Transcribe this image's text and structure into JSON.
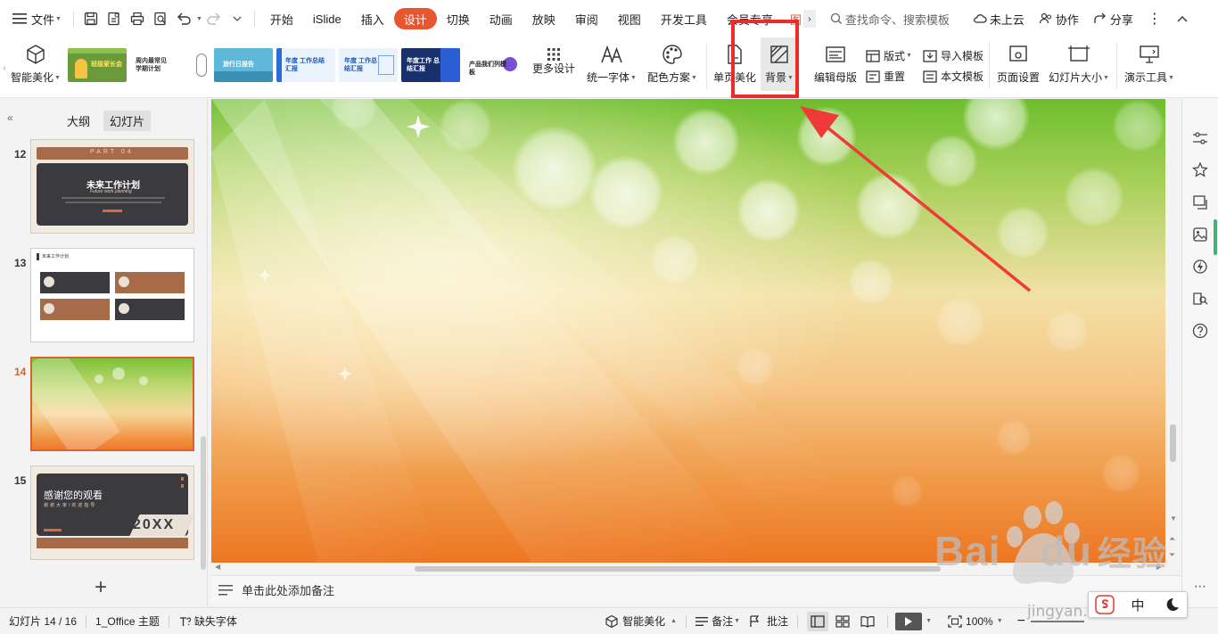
{
  "menubar": {
    "file_label": "文件",
    "tabs": [
      {
        "label": "开始",
        "active": false
      },
      {
        "label": "iSlide",
        "active": false
      },
      {
        "label": "插入",
        "active": false
      },
      {
        "label": "设计",
        "active": true
      },
      {
        "label": "切换",
        "active": false
      },
      {
        "label": "动画",
        "active": false
      },
      {
        "label": "放映",
        "active": false
      },
      {
        "label": "审阅",
        "active": false
      },
      {
        "label": "视图",
        "active": false
      },
      {
        "label": "开发工具",
        "active": false
      },
      {
        "label": "会员专享",
        "active": false
      }
    ],
    "more_tab_label": "图",
    "search_placeholder": "查找命令、搜索模板",
    "cloud_label": "未上云",
    "collab_label": "协作",
    "share_label": "分享"
  },
  "ribbon": {
    "smart_beautify_label": "智能美化",
    "templates": [
      {
        "text": "班级家长会",
        "bg": "#6a9a3a",
        "fg": "#ffe66a"
      },
      {
        "text": "周内最常见 学期计划",
        "bg": "#ffffff",
        "fg": "#333333"
      },
      {
        "text": "",
        "bg": "#ffffff",
        "fg": "#333333"
      },
      {
        "text": "旅行日报告",
        "bg": "#5fb7d9",
        "fg": "#ffffff"
      },
      {
        "text": "年度 工作总结汇报",
        "bg": "#eaf2fb",
        "fg": "#1d58b8"
      },
      {
        "text": "年度 工作总结汇报",
        "bg": "#eaf2fb",
        "fg": "#1d58b8"
      },
      {
        "text": "年度工作 总结汇报",
        "bg": "#18306b",
        "fg": "#ffffff"
      },
      {
        "text": "产品我们列模板",
        "bg": "#ffffff",
        "fg": "#222222"
      }
    ],
    "more_design_label": "更多设计",
    "unify_font_label": "统一字体",
    "color_scheme_label": "配色方案",
    "single_page_label": "单页美化",
    "background_label": "背景",
    "edit_master_label": "编辑母版",
    "layout_label": "版式",
    "reset_label": "重置",
    "import_template_label": "导入模板",
    "text_template_label": "本文模板",
    "page_setup_label": "页面设置",
    "slide_size_label": "幻灯片大小",
    "presentation_tools_label": "演示工具"
  },
  "left_panel": {
    "tab_outline": "大纲",
    "tab_slides": "幻灯片",
    "slides": [
      {
        "num": "12",
        "title": "未来工作计划",
        "subtitle": "Future work planning",
        "header": "PART 04",
        "current": false
      },
      {
        "num": "13",
        "title": "未来工作计划",
        "current": false
      },
      {
        "num": "14",
        "current": true
      },
      {
        "num": "15",
        "title": "感谢您的观看",
        "subtitle": "谢谢大家/欢迎指导",
        "year": "20XX",
        "current": false
      }
    ]
  },
  "notes": {
    "placeholder": "单击此处添加备注"
  },
  "statusbar": {
    "slide_counter": "幻灯片 14 / 16",
    "theme": "1_Office 主题",
    "missing_font": "缺失字体",
    "smart_beautify": "智能美化",
    "notes": "备注",
    "comments": "批注",
    "zoom": "100%"
  },
  "watermark": {
    "brand": "Bai",
    "brand2": "du",
    "cn": "经验",
    "url": "jingyan.baidu.com"
  },
  "ime": {
    "mode": "中"
  },
  "colors": {
    "accent": "#e8552f",
    "highlight": "#f02a2a",
    "arrow": "#f03a3a",
    "current_slide": "#d9622b"
  }
}
